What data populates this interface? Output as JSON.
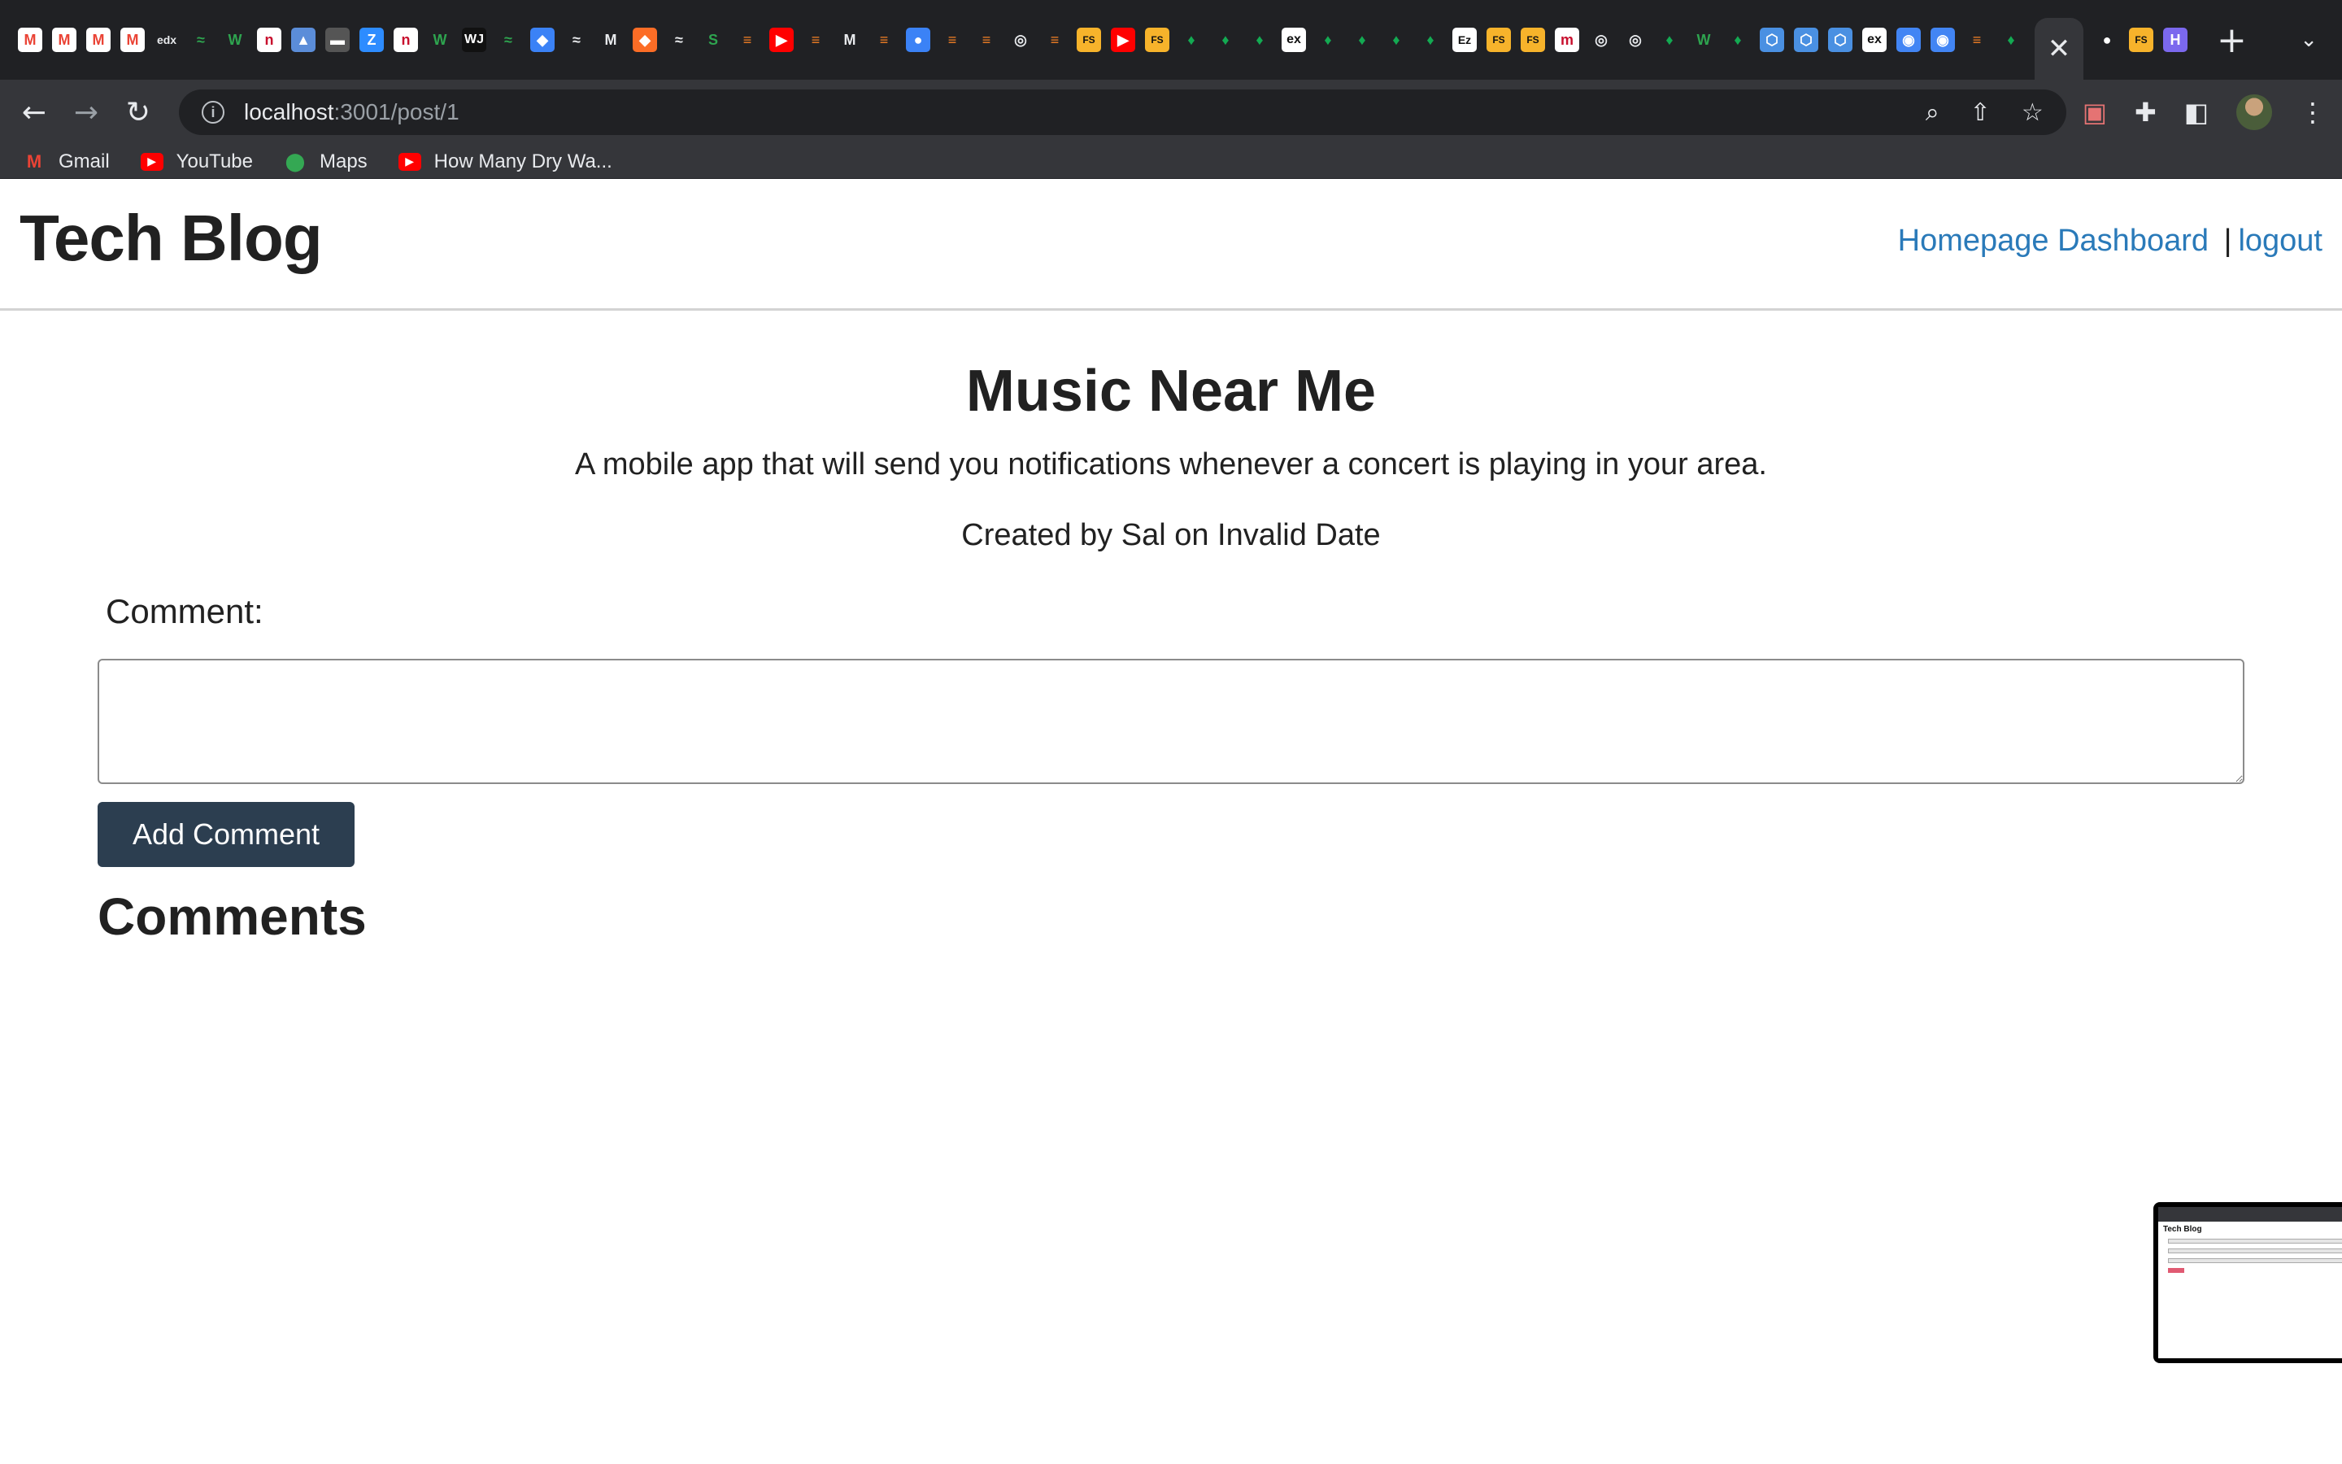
{
  "browser": {
    "url_host": "localhost",
    "url_path": ":3001/post/1",
    "bookmarks": [
      {
        "label": "Gmail",
        "icon": "gmail-icon",
        "color": "#ea4335"
      },
      {
        "label": "YouTube",
        "icon": "youtube-icon",
        "color": "#ff0000"
      },
      {
        "label": "Maps",
        "icon": "maps-icon",
        "color": "#34a853"
      },
      {
        "label": "How Many Dry Wa...",
        "icon": "youtube-icon",
        "color": "#ff0000"
      }
    ]
  },
  "header": {
    "site_title": "Tech Blog",
    "nav_homepage": "Homepage",
    "nav_dashboard": "Dashboard",
    "nav_separator": "|",
    "nav_logout": "logout"
  },
  "post": {
    "title": "Music Near Me",
    "body": "A mobile app that will send you notifications whenever a concert is playing in your area.",
    "meta": "Created by Sal on Invalid Date"
  },
  "comment_form": {
    "label": "Comment:",
    "value": "",
    "submit_label": "Add Comment"
  },
  "comments": {
    "heading": "Comments"
  },
  "thumbnail": {
    "title": "Tech Blog"
  },
  "colors": {
    "link": "#2a7ab9",
    "button_bg": "#2c3e50",
    "chrome_bg": "#35363a",
    "tabstrip_bg": "#202124"
  }
}
